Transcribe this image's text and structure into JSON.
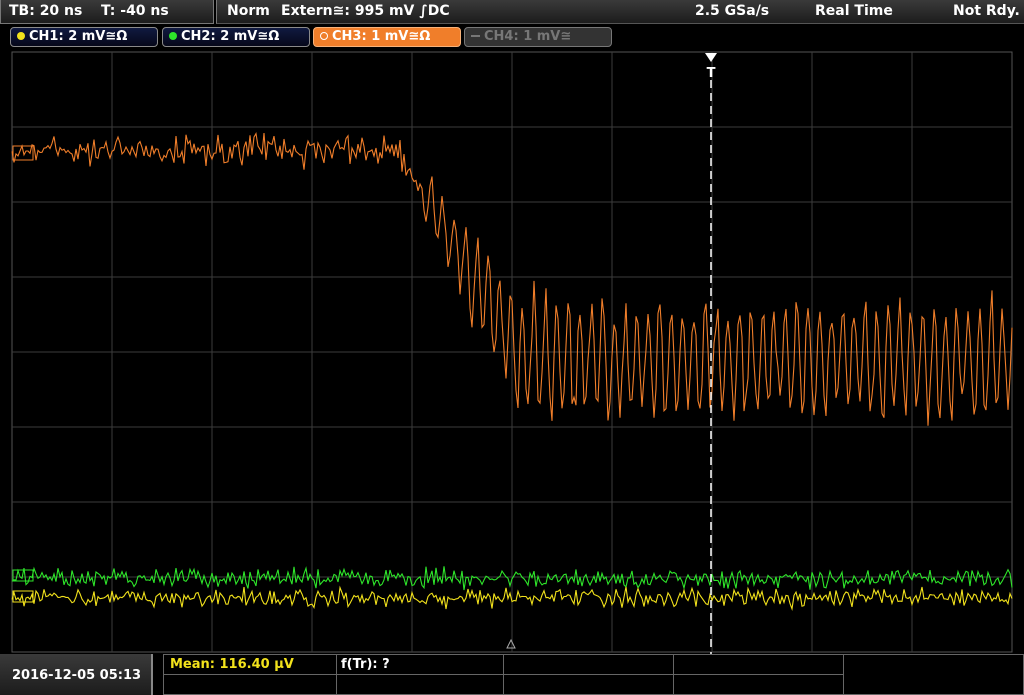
{
  "status": {
    "timebase": "TB: 20 ns",
    "trigger_offset": "T: -40 ns",
    "mode": "Norm",
    "trigger_source": "Extern≅: 995 mV ∫DC",
    "sample_rate": "2.5 GSa/s",
    "acquisition": "Real Time",
    "state": "Not Rdy."
  },
  "channels": [
    {
      "label": "CH1: 2 mV≅Ω",
      "color": "#f2e21c",
      "state": "on"
    },
    {
      "label": "CH2: 2 mV≅Ω",
      "color": "#2ee62a",
      "state": "on"
    },
    {
      "label": "CH3: 1 mV≅Ω",
      "color": "#f07e2a",
      "state": "active"
    },
    {
      "label": "CH4: 1 mV≅",
      "color": "#8a8a8a",
      "state": "off"
    }
  ],
  "trigger_marker": "T",
  "waveform_colors": {
    "ch1": "#f2e21c",
    "ch2": "#2ee62a",
    "ch3": "#f07e2a",
    "grid": "#3c3c3c"
  },
  "footer": {
    "datetime": "2016-12-05 05:13",
    "mean_label": "Mean: 116.40 µV",
    "ftr_label": "f(Tr): ?"
  }
}
